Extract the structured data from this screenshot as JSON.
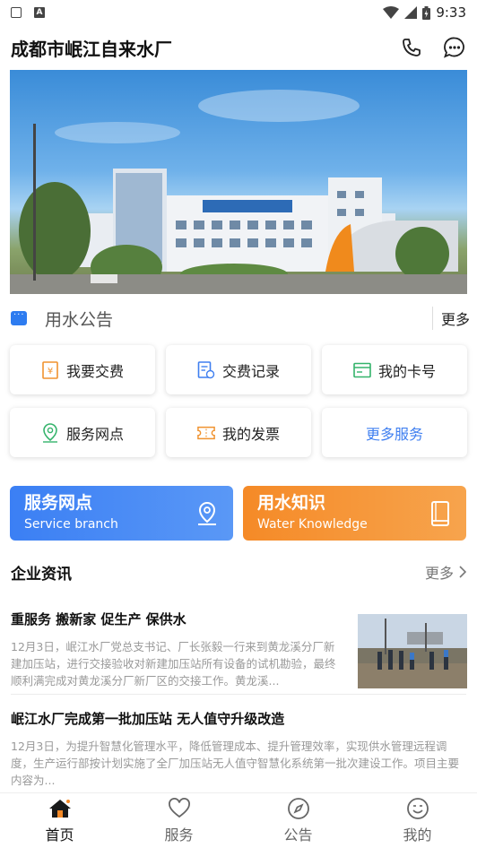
{
  "status_bar": {
    "time": "9:33"
  },
  "header": {
    "title": "成都市岷江自来水厂"
  },
  "notice": {
    "title": "用水公告",
    "more": "更多"
  },
  "services": [
    {
      "label": "我要交费",
      "icon": "payment-icon",
      "color": "#f0922f"
    },
    {
      "label": "交费记录",
      "icon": "record-icon",
      "color": "#3f7ff0"
    },
    {
      "label": "我的卡号",
      "icon": "card-icon",
      "color": "#34b36b"
    },
    {
      "label": "服务网点",
      "icon": "location-pin-icon",
      "color": "#34b36b"
    },
    {
      "label": "我的发票",
      "icon": "invoice-icon",
      "color": "#f0922f"
    },
    {
      "label": "更多服务"
    }
  ],
  "feature_cards": [
    {
      "title": "服务网点",
      "subtitle": "Service branch",
      "icon": "location-pin-icon",
      "color": "#3b7ff4"
    },
    {
      "title": "用水知识",
      "subtitle": "Water Knowledge",
      "icon": "book-icon",
      "color": "#f58a27"
    }
  ],
  "news": {
    "title": "企业资讯",
    "more": "更多",
    "items": [
      {
        "title": "重服务 搬新家 促生产 保供水",
        "body": "12月3日，岷江水厂党总支书记、厂长张毅一行来到黄龙溪分厂新建加压站，进行交接验收对新建加压站所有设备的试机勘验，最终顺利满完成对黄龙溪分厂新厂区的交接工作。黄龙溪..."
      },
      {
        "title": "岷江水厂完成第一批加压站 无人值守升级改造",
        "body": "12月3日，为提升智慧化管理水平，降低管理成本、提升管理效率，实现供水管理远程调度，生产运行部按计划实施了全厂加压站无人值守智慧化系统第一批次建设工作。项目主要内容为..."
      }
    ]
  },
  "bottom_nav": [
    {
      "label": "首页",
      "icon": "home-icon",
      "active": true
    },
    {
      "label": "服务",
      "icon": "heart-icon"
    },
    {
      "label": "公告",
      "icon": "compass-icon"
    },
    {
      "label": "我的",
      "icon": "smiley-icon"
    }
  ],
  "colors": {
    "accent_blue": "#3b7ff4",
    "accent_orange": "#f58a27",
    "accent_green": "#34b36b"
  }
}
